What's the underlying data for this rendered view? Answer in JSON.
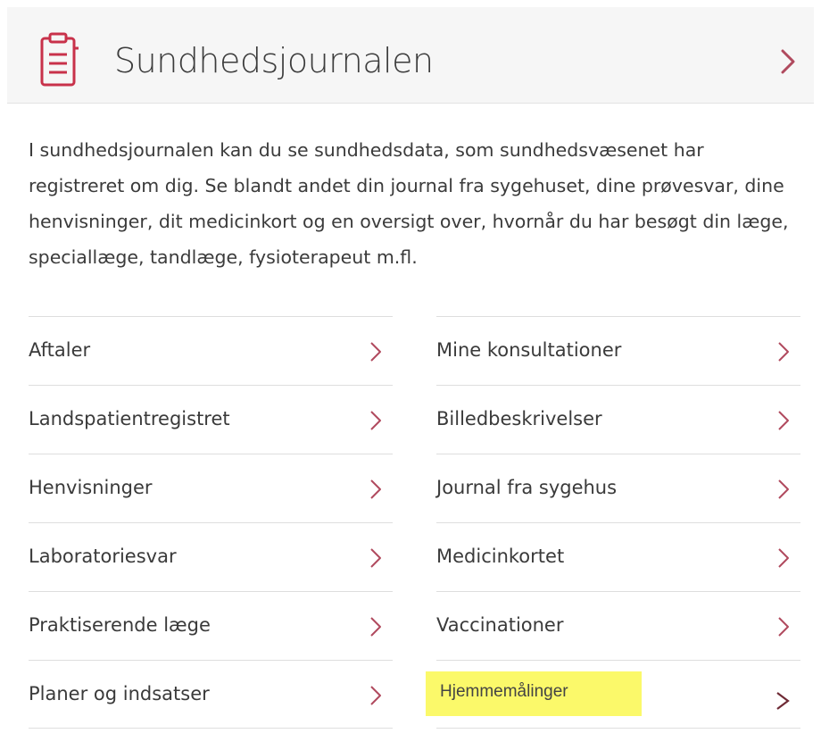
{
  "header": {
    "title": "Sundhedsjournalen",
    "icon": "document-list-icon",
    "accent": "#c8314a"
  },
  "intro": {
    "text": "I sundhedsjournalen kan du se sundhedsdata, som sundhedsvæsenet har registreret om dig. Se blandt andet din journal fra sygehuset, dine prøvesvar, dine henvisninger, dit medicinkort og en oversigt over, hvornår du har besøgt din læge, speciallæge, tandlæge, fysioterapeut m.fl."
  },
  "left_links": [
    {
      "label": "Aftaler"
    },
    {
      "label": "Landspatientregistret"
    },
    {
      "label": "Henvisninger"
    },
    {
      "label": "Laboratoriesvar"
    },
    {
      "label": "Praktiserende læge"
    },
    {
      "label": "Planer og indsatser"
    }
  ],
  "right_links": [
    {
      "label": "Mine konsultationer"
    },
    {
      "label": "Billedbeskrivelser"
    },
    {
      "label": "Journal fra sygehus"
    },
    {
      "label": "Medicinkortet"
    },
    {
      "label": "Vaccinationer"
    },
    {
      "label": "Hjemmemålinger",
      "highlighted": true,
      "highlight_color": "#fbf96a"
    }
  ],
  "colors": {
    "chevron": "#b04a5e",
    "chevron_dark": "#6e2a35",
    "divider": "#dedede"
  }
}
